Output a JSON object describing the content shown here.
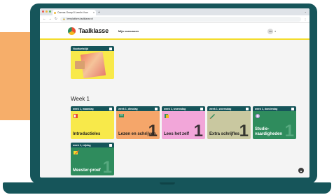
{
  "browser": {
    "tab_title": "Canvas Groep 8 Leerlin Voor",
    "url": "leerplatform.taalklasse.nl"
  },
  "app": {
    "logo_text": "Taalklasse",
    "nav_link": "Mijn cursussen",
    "user_initials": "KM"
  },
  "voortoets": {
    "label": "Voortoetstijd"
  },
  "week_heading": "Week 1",
  "cards": [
    {
      "day": "week 1, maandag",
      "title": "Introductieles",
      "number": "",
      "color": "#f8e94a"
    },
    {
      "day": "week 1, dinsdag",
      "title": "Lezen en schrijven",
      "number": "1",
      "color": "#f5a66a"
    },
    {
      "day": "week 1, woensdag",
      "title": "Lees het zelf",
      "number": "1",
      "color": "#f2a6d9"
    },
    {
      "day": "week 1, woensdag",
      "title": "Extra schrijfles",
      "number": "1",
      "color": "#c9c8a0"
    },
    {
      "day": "week 1, donderdag",
      "title": "Studie-vaardigheden",
      "number": "1",
      "color": "#2f8c5d"
    },
    {
      "day": "week 1, vrijdag",
      "title": "Meester-proef",
      "number": "1",
      "color": "#2f8c5d"
    }
  ],
  "colors": {
    "device": "#16555a",
    "accent_yellow": "#f3dc2b",
    "orange_block": "#f6ae6a"
  }
}
